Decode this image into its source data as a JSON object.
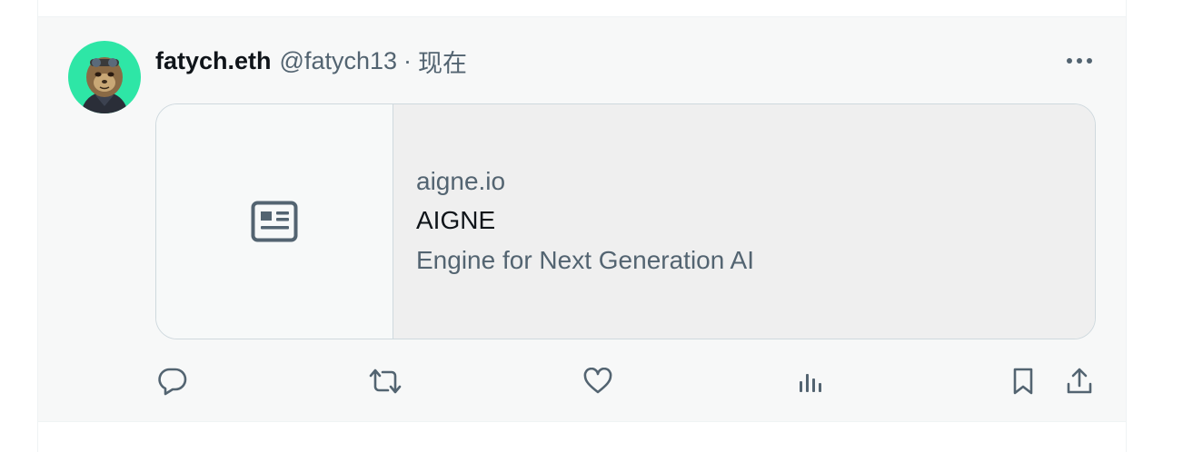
{
  "tweet": {
    "display_name": "fatych.eth",
    "handle": "@fatych13",
    "separator": "·",
    "time": "现在",
    "avatar_colors": {
      "background": "#2ee6a6",
      "skin": "#8a6a45",
      "jacket": "#2a2e38"
    }
  },
  "card": {
    "domain": "aigne.io",
    "title": "AIGNE",
    "description": "Engine for Next Generation AI",
    "media_icon": "article-icon"
  },
  "actions": [
    {
      "name": "reply",
      "icon": "reply-icon"
    },
    {
      "name": "retweet",
      "icon": "retweet-icon"
    },
    {
      "name": "like",
      "icon": "heart-icon"
    },
    {
      "name": "views",
      "icon": "analytics-icon"
    },
    {
      "name": "bookmark",
      "icon": "bookmark-icon"
    },
    {
      "name": "share",
      "icon": "share-icon"
    }
  ],
  "colors": {
    "text_primary": "#0f1419",
    "text_secondary": "#536471",
    "border": "#cfd9de",
    "hover_background": "#f7f8f8"
  }
}
